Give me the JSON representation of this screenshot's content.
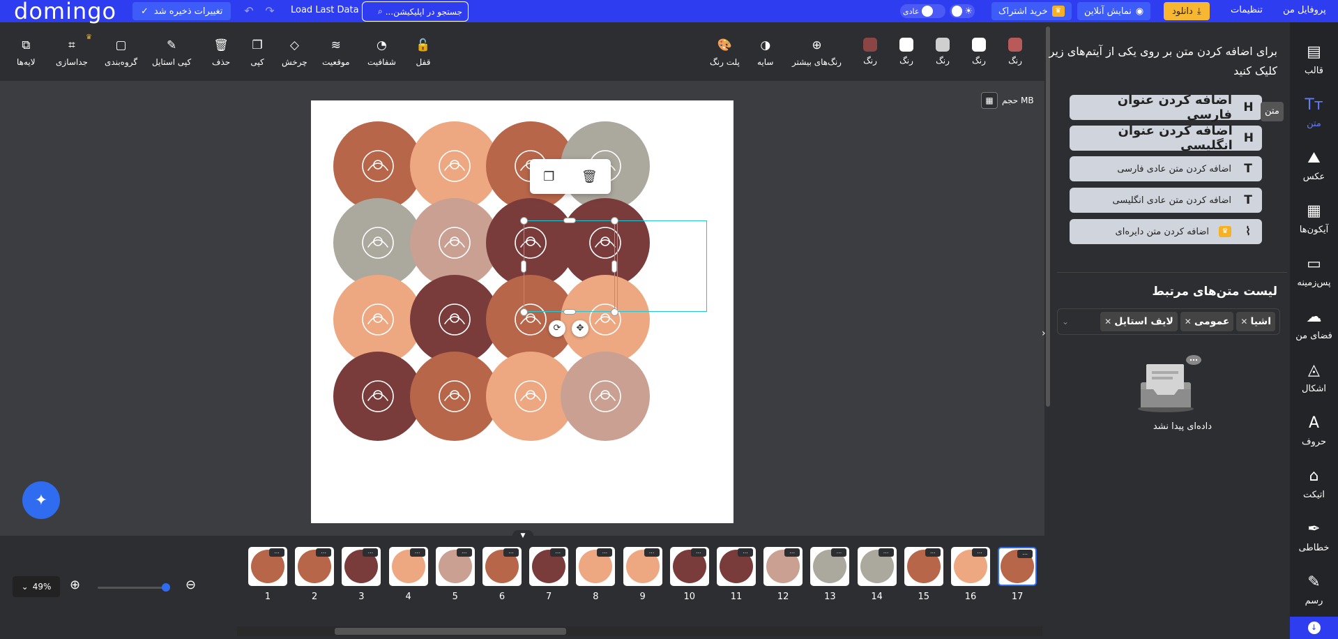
{
  "app": {
    "logo": "domingo"
  },
  "topbar": {
    "saved": "تغییرات ذخیره شد",
    "load_last": "Load Last Data",
    "search_placeholder": "جستجو در اپلیکیشن...",
    "mode": "عادی",
    "subscribe": "خرید اشتراک",
    "online": "نمایش آنلاین",
    "download": "دانلود",
    "settings": "تنظیمات",
    "profile": "پروفایل من"
  },
  "toolbar": {
    "layers": "لایه‌ها",
    "separate": "جداسازی",
    "group": "گروه‌بندی",
    "copy_style": "کپی استایل",
    "delete": "حذف",
    "copy": "کپی",
    "rotate": "چرخش",
    "position": "موقعیت",
    "opacity": "شفافیت",
    "lock": "قفل",
    "palette": "پلت رنگ",
    "shadow": "سایه",
    "more_colors": "رنگ‌های بیشتر",
    "color": "رنگ",
    "swatches": [
      "#8b4545",
      "#ffffff",
      "#ffffff",
      "#d0cfcf",
      "#b85a5a"
    ]
  },
  "workspace": {
    "size_label": "حجم MB"
  },
  "canvas": {
    "circle_colors": [
      "#b8664a",
      "#eda882",
      "#b8664a",
      "#aba89d",
      "#aba89d",
      "#c9a091",
      "#7a3b3b",
      "#7a3b3b",
      "#eda882",
      "#7a3b3b",
      "#b8664a",
      "#eda882",
      "#7a3b3b",
      "#b8664a",
      "#eda882",
      "#c9a091"
    ]
  },
  "pages": {
    "zoom": "49%",
    "items": [
      {
        "num": "1",
        "color": "#b8664a"
      },
      {
        "num": "2",
        "color": "#b8664a"
      },
      {
        "num": "3",
        "color": "#7a3b3b"
      },
      {
        "num": "4",
        "color": "#eda882"
      },
      {
        "num": "5",
        "color": "#c9a091"
      },
      {
        "num": "6",
        "color": "#b8664a"
      },
      {
        "num": "7",
        "color": "#7a3b3b"
      },
      {
        "num": "8",
        "color": "#eda882"
      },
      {
        "num": "9",
        "color": "#eda882"
      },
      {
        "num": "10",
        "color": "#7a3b3b"
      },
      {
        "num": "11",
        "color": "#7a3b3b"
      },
      {
        "num": "12",
        "color": "#c9a091"
      },
      {
        "num": "13",
        "color": "#aba89d"
      },
      {
        "num": "14",
        "color": "#aba89d"
      },
      {
        "num": "15",
        "color": "#b8664a"
      },
      {
        "num": "16",
        "color": "#eda882"
      },
      {
        "num": "17",
        "color": "#b8664a"
      }
    ],
    "more": "..."
  },
  "panel": {
    "title": "برای اضافه کردن متن بر روی یکی از آیتم‌های زیر کلیک کنید",
    "add_fa_heading": "اضافه کردن عنوان فارسی",
    "add_en_heading": "اضافه کردن عنوان انگلیسی",
    "add_fa_text": "اضافه کردن متن عادی فارسی",
    "add_en_text": "اضافه کردن متن عادی انگلیسی",
    "add_circle_text": "اضافه کردن متن دایره‌ای",
    "related_title": "لیست متن‌های مرتبط",
    "tags": [
      "اشیا",
      "عمومی",
      "لایف استایل"
    ],
    "empty": "داده‌ای پیدا نشد",
    "tooltip": "متن"
  },
  "nav": {
    "items": [
      "قالب",
      "متن",
      "عکس",
      "آیکون‌ها",
      "پس‌زمینه",
      "فضای من",
      "اشکال",
      "حروف",
      "اتیکت",
      "خطاطی",
      "رسم"
    ]
  }
}
